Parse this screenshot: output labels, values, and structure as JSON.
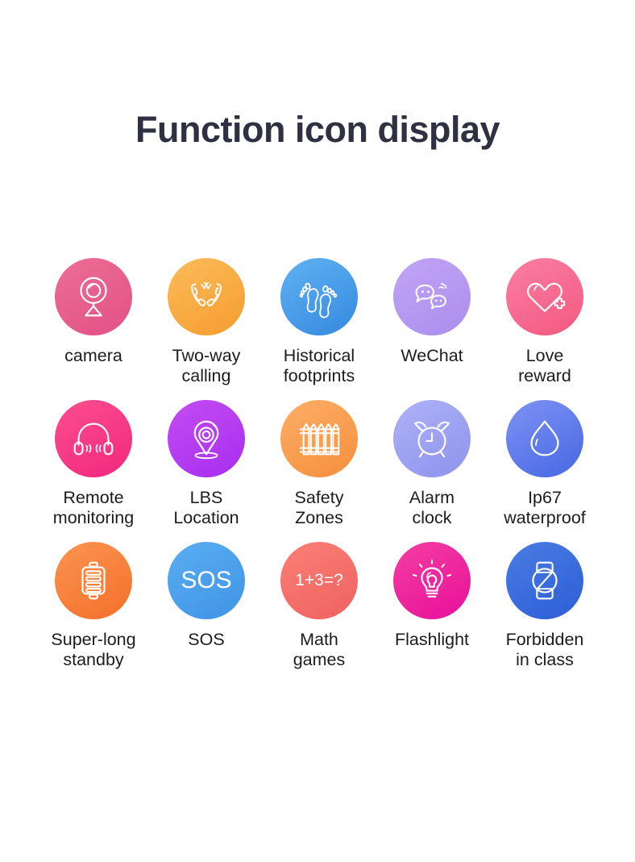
{
  "page": {
    "title": "Function icon display",
    "background_color": "#ffffff",
    "title_color": "#2f3142"
  },
  "grid": {
    "columns": 5,
    "rows": 3,
    "items": [
      {
        "id": "camera",
        "label": "camera",
        "icon": "webcam-icon",
        "gradient_from": "#ec6e95",
        "gradient_to": "#e25185"
      },
      {
        "id": "two-way-calling",
        "label": "Two-way\ncalling",
        "icon": "two-handsets-icon",
        "gradient_from": "#fbbc5a",
        "gradient_to": "#f59c2e"
      },
      {
        "id": "historical-footprints",
        "label": "Historical\nfootprints",
        "icon": "footprints-icon",
        "gradient_from": "#5fb2f2",
        "gradient_to": "#3589df"
      },
      {
        "id": "wechat",
        "label": "WeChat",
        "icon": "chat-bubbles-icon",
        "gradient_from": "#c1a5f5",
        "gradient_to": "#ab8ded"
      },
      {
        "id": "love-reward",
        "label": "Love\nreward",
        "icon": "heart-plus-icon",
        "gradient_from": "#fa7fa3",
        "gradient_to": "#f4587f"
      },
      {
        "id": "remote-monitoring",
        "label": "Remote\nmonitoring",
        "icon": "headphones-icon",
        "gradient_from": "#fb4f8f",
        "gradient_to": "#f3277e"
      },
      {
        "id": "lbs-location",
        "label": "LBS\nLocation",
        "icon": "map-pin-icon",
        "gradient_from": "#c34df2",
        "gradient_to": "#a72ef0"
      },
      {
        "id": "safety-zones",
        "label": "Safety\nZones",
        "icon": "fence-icon",
        "gradient_from": "#fbae67",
        "gradient_to": "#f68f3b"
      },
      {
        "id": "alarm-clock",
        "label": "Alarm\nclock",
        "icon": "alarm-clock-icon",
        "gradient_from": "#afb2f5",
        "gradient_to": "#8e92ed"
      },
      {
        "id": "ip67-waterproof",
        "label": "Ip67\nwaterproof",
        "icon": "water-drop-icon",
        "gradient_from": "#7f92f3",
        "gradient_to": "#4668e4"
      },
      {
        "id": "super-long-standby",
        "label": "Super-long\nstandby",
        "icon": "battery-icon",
        "gradient_from": "#fb9450",
        "gradient_to": "#f4702a"
      },
      {
        "id": "sos",
        "label": "SOS",
        "icon": "sos-text-icon",
        "icon_text": "SOS",
        "gradient_from": "#5aaef0",
        "gradient_to": "#3f93e6"
      },
      {
        "id": "math-games",
        "label": "Math\ngames",
        "icon": "math-text-icon",
        "icon_text": "1+3=?",
        "gradient_from": "#fa8076",
        "gradient_to": "#f0615f"
      },
      {
        "id": "flashlight",
        "label": "Flashlight",
        "icon": "light-bulb-icon",
        "gradient_from": "#f43fa0",
        "gradient_to": "#e80f9b"
      },
      {
        "id": "forbidden-in-class",
        "label": "Forbidden\nin class",
        "icon": "watch-forbidden-icon",
        "gradient_from": "#4a7ce4",
        "gradient_to": "#2d5ed6"
      }
    ]
  }
}
